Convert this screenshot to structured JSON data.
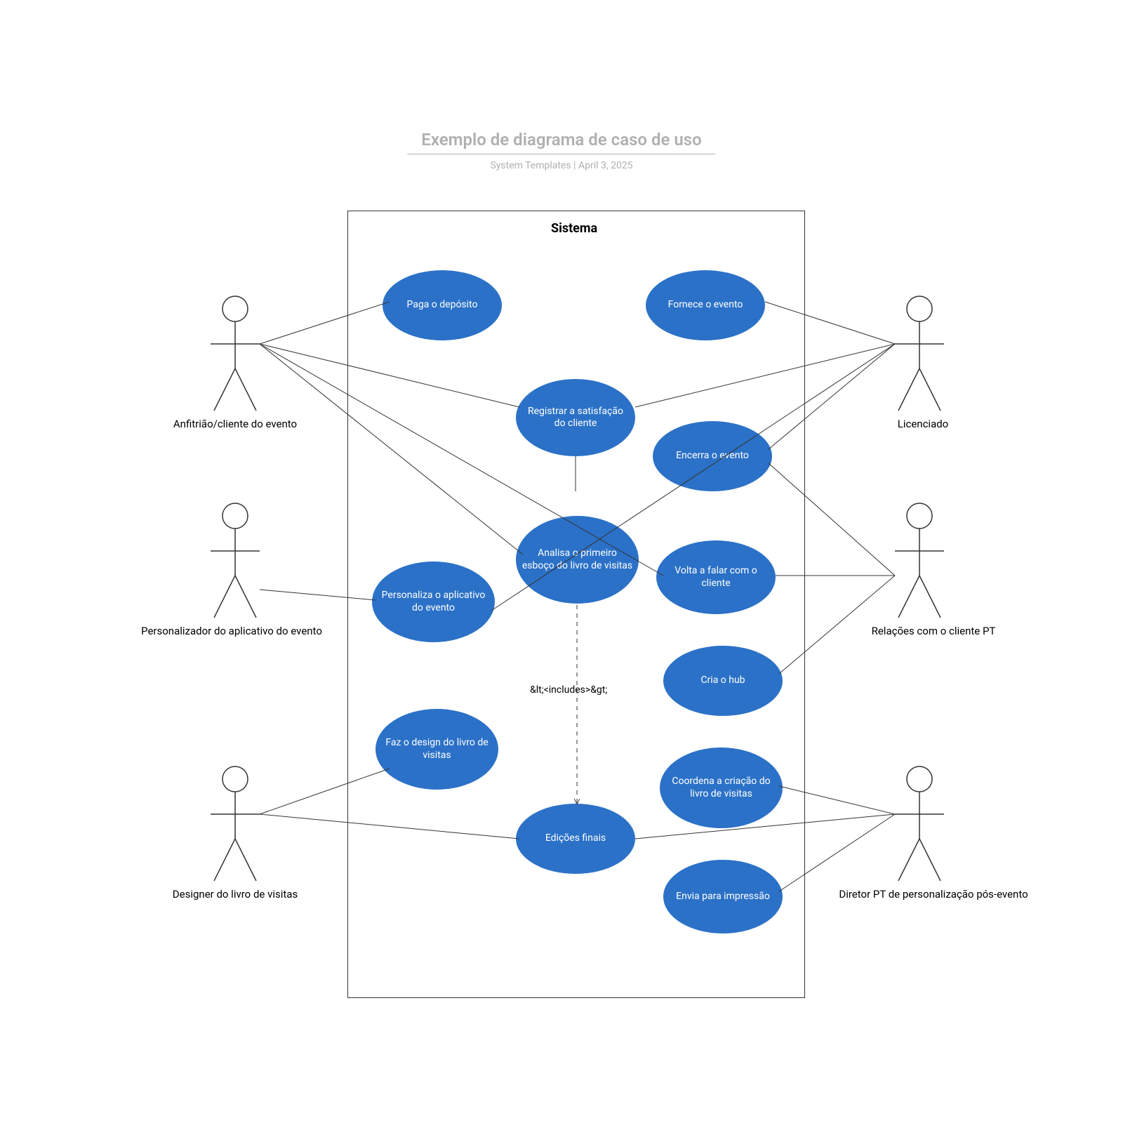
{
  "title": "Exemplo de diagrama de caso de uso",
  "subtitle_author": "System Templates",
  "subtitle_sep": "  |  ",
  "subtitle_date": "April 3, 2025",
  "system_label": "Sistema",
  "includes_label": "&lt;<includes>&gt;",
  "actors": {
    "host": {
      "label": "Anfitrião/cliente do evento"
    },
    "customizer": {
      "label": "Personalizador do aplicativo do evento"
    },
    "designer": {
      "label": "Designer do livro de visitas"
    },
    "licensee": {
      "label": "Licenciado"
    },
    "relations": {
      "label": "Relações com o cliente PT"
    },
    "director": {
      "label": "Diretor PT de personalização pós-evento"
    }
  },
  "usecases": {
    "deposit": "Paga o depósito",
    "provide": "Fornece o evento",
    "satisfaction": "Registrar a satisfação do cliente",
    "close": "Encerra o evento",
    "review": "Analisa o primeiro esboço do livro de visitas",
    "followup": "Volta a falar com o cliente",
    "customize": "Personaliza o aplicativo do evento",
    "hub": "Cria o hub",
    "design": "Faz o design do livro de visitas",
    "coord": "Coordena a criação do livro de visitas",
    "final": "Edições finais",
    "print": "Envia para impressão"
  }
}
